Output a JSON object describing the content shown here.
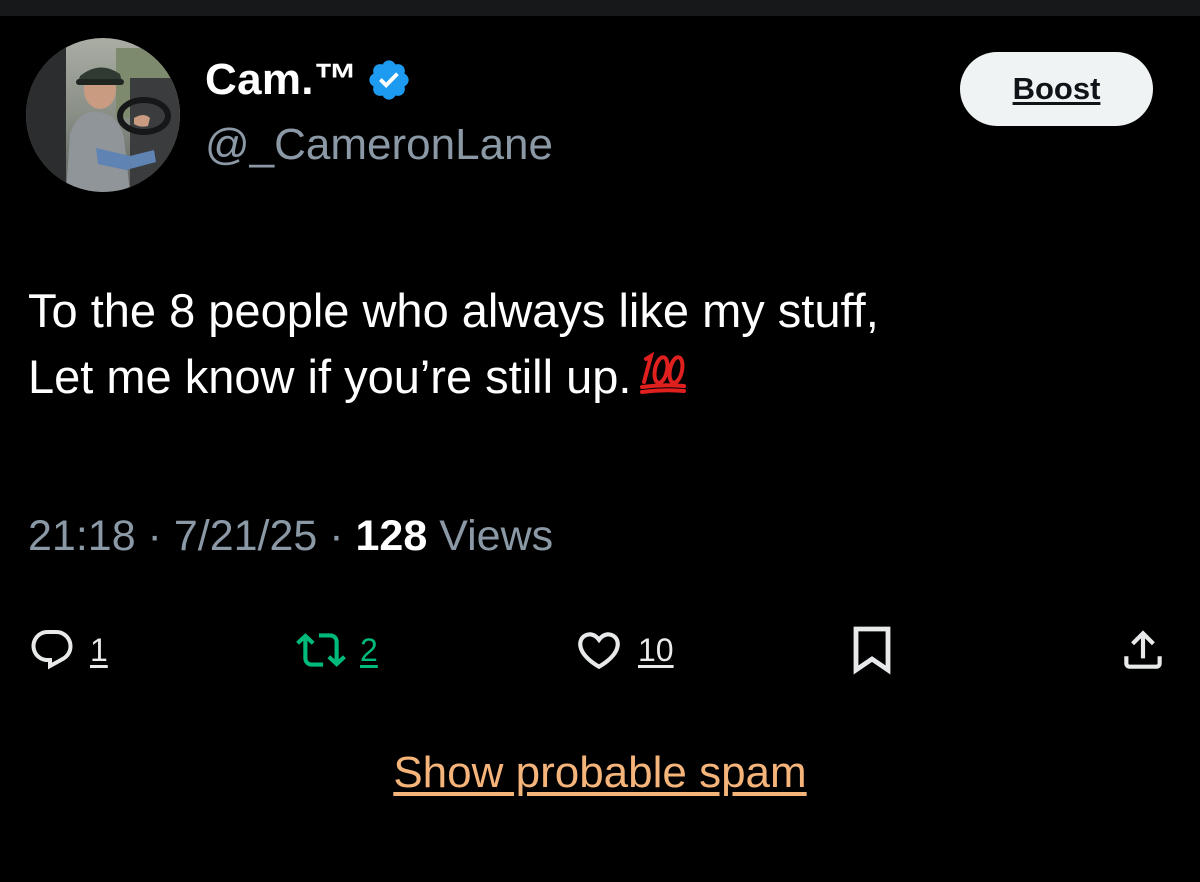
{
  "author": {
    "display_name": "Cam.™",
    "handle": "@_CameronLane",
    "verified": true,
    "avatar_icon": "avatar-photo"
  },
  "boost_label": "Boost",
  "tweet": {
    "line1": "To the 8 people who always like my stuff,",
    "line2": "Let me know if you’re still up.",
    "emoji": "hundred-points-emoji"
  },
  "meta": {
    "time": "21:18",
    "separator": " · ",
    "date": "7/21/25",
    "views_count": "128",
    "views_label": " Views"
  },
  "actions": {
    "reply_count": "1",
    "repost_count": "2",
    "like_count": "10"
  },
  "spam_link_label": "Show probable spam",
  "colors": {
    "background": "#000000",
    "verified_blue": "#1d9bf0",
    "repost_green": "#00ba7c",
    "spam_link": "#f5b47a",
    "secondary_text": "#8b98a5"
  }
}
